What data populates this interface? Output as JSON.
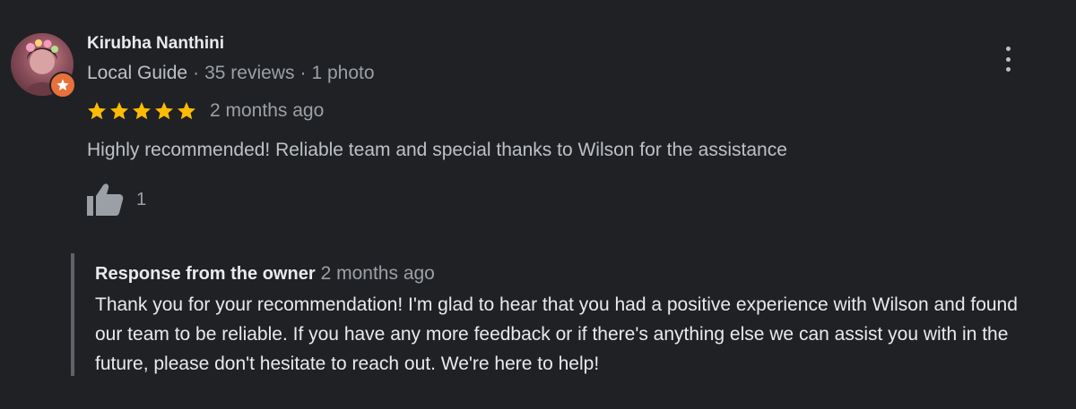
{
  "review": {
    "reviewer_name": "Kirubha Nanthini",
    "reviewer_level": "Local Guide",
    "reviews_count": "35 reviews",
    "photos_count": "1 photo",
    "separator": "·",
    "rating": 5,
    "rating_max": 5,
    "date": "2 months ago",
    "text": "Highly recommended! Reliable team and special thanks to Wilson for the assistance",
    "likes": "1",
    "menu_icon": "more-vert-icon",
    "like_icon": "thumb-up-icon",
    "badge_icon": "local-guide-star-icon"
  },
  "owner_response": {
    "title": "Response from the owner",
    "date": "2 months ago",
    "text": "Thank you for your recommendation! I'm glad to hear that you had a positive experience with Wilson and found our team to be reliable. If you have any more feedback or if there's anything else we can assist you with in the future, please don't hesitate to reach out. We're here to help!"
  },
  "colors": {
    "background": "#202124",
    "star": "#fbbc04",
    "guide_badge": "#e8703a",
    "response_border": "#5f6368"
  }
}
